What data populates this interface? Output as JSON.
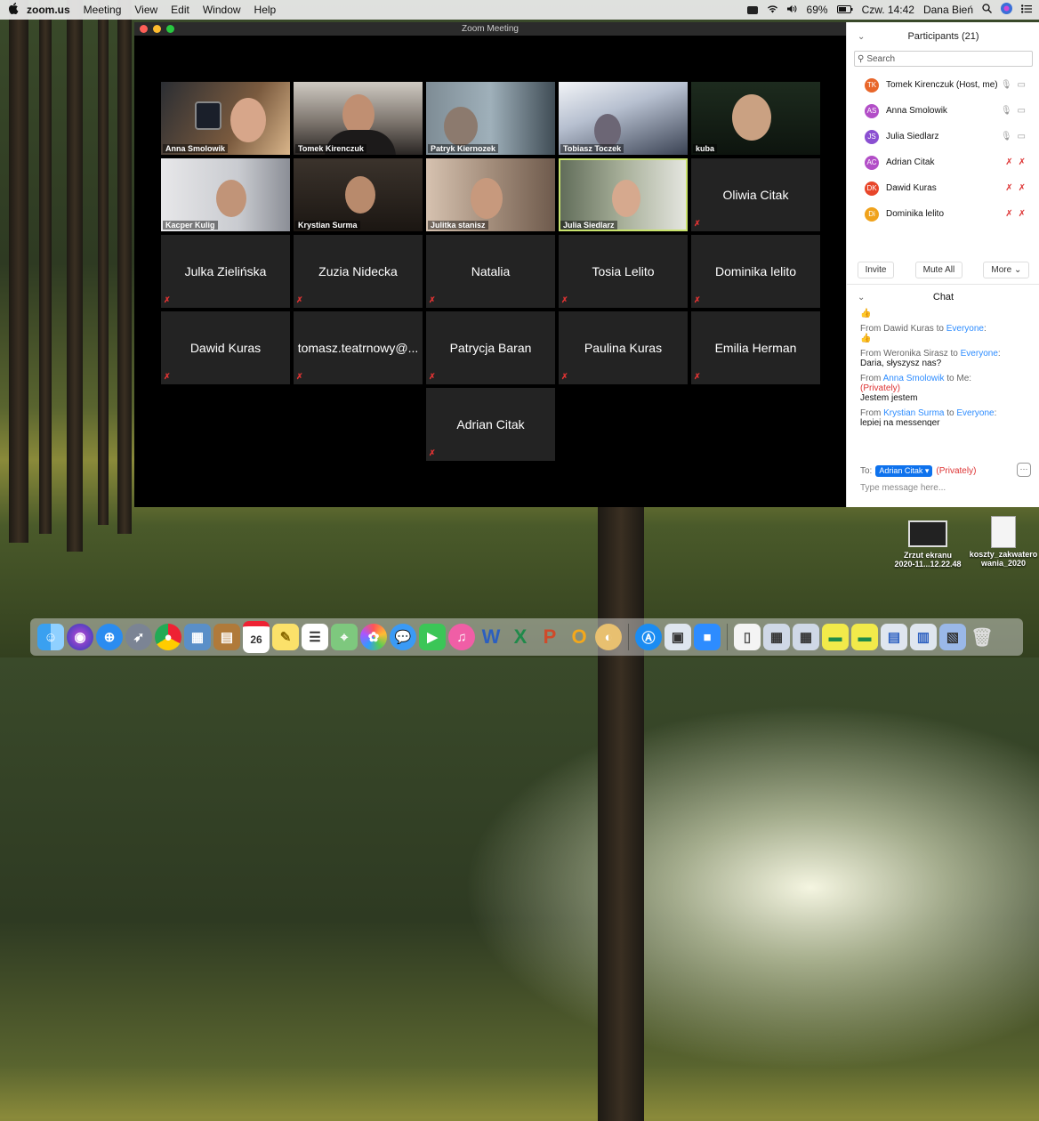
{
  "menubar": {
    "apple": "",
    "items": [
      "zoom.us",
      "Meeting",
      "View",
      "Edit",
      "Window",
      "Help"
    ],
    "battery": "69%",
    "clock": "Czw. 14:42",
    "user": "Dana Bień"
  },
  "window": {
    "title": "Zoom Meeting"
  },
  "tiles": [
    {
      "name": "Anna Smolowik",
      "video": true
    },
    {
      "name": "Tomek Kirenczuk",
      "video": true
    },
    {
      "name": "Patryk Kiernozek",
      "video": true
    },
    {
      "name": "Tobiasz  Toczek",
      "video": true
    },
    {
      "name": "kuba",
      "video": true
    },
    {
      "name": "Kacper Kulig",
      "video": true
    },
    {
      "name": "Krystian Surma",
      "video": true
    },
    {
      "name": "Julitka stanisz",
      "video": true
    },
    {
      "name": "Julia Siedlarz",
      "video": true
    },
    {
      "name": "Oliwia Citak",
      "video": false
    },
    {
      "name": "Julka Zielińska",
      "video": false
    },
    {
      "name": "Zuzia Nidecka",
      "video": false
    },
    {
      "name": "Natalia",
      "video": false
    },
    {
      "name": "Tosia Lelito",
      "video": false
    },
    {
      "name": "Dominika lelito",
      "video": false
    },
    {
      "name": "Dawid Kuras",
      "video": false
    },
    {
      "name": "tomasz.teatrnowy@...",
      "video": false
    },
    {
      "name": "Patrycja Baran",
      "video": false
    },
    {
      "name": "Paulina Kuras",
      "video": false
    },
    {
      "name": "Emilia Herman",
      "video": false
    },
    {
      "name": "Adrian Citak",
      "video": false
    }
  ],
  "participants": {
    "header": "Participants (21)",
    "search_placeholder": "Search",
    "list": [
      {
        "initials": "TK",
        "name": "Tomek Kirenczuk (Host, me)",
        "color": "#e8662a",
        "muted": false
      },
      {
        "initials": "AS",
        "name": "Anna Smolowik",
        "color": "#b24ec7",
        "muted": false
      },
      {
        "initials": "JS",
        "name": "Julia Siedlarz",
        "color": "#8a4fd1",
        "muted": false
      },
      {
        "initials": "AC",
        "name": "Adrian Citak",
        "color": "#b24ec7",
        "muted": true
      },
      {
        "initials": "DK",
        "name": "Dawid Kuras",
        "color": "#e8462a",
        "muted": true
      },
      {
        "initials": "Di",
        "name": "Dominika lelito",
        "color": "#f0a21b",
        "muted": true
      }
    ],
    "invite": "Invite",
    "mute_all": "Mute All",
    "more": "More"
  },
  "chat": {
    "header": "Chat",
    "first_emoji": "👍",
    "messages": [
      {
        "from_prefix": "From ",
        "from": "Dawid Kuras",
        "to_prefix": " to ",
        "to": "Everyone",
        "tail": ":",
        "private": "",
        "text": "👍"
      },
      {
        "from_prefix": "From ",
        "from": "Weronika Sirasz",
        "to_prefix": " to ",
        "to": "Everyone",
        "tail": ":",
        "private": "",
        "text": "Daria, słyszysz nas?"
      },
      {
        "from_prefix": "From ",
        "from": "Anna Smolowik",
        "to_prefix": " to ",
        "to": "Me",
        "tail": ":",
        "private": "(Privately)",
        "text": "Jestem jestem"
      },
      {
        "from_prefix": "From ",
        "from": "Krystian Surma",
        "to_prefix": " to ",
        "to": "Everyone",
        "tail": ":",
        "private": "",
        "text": "lepiej na messenger"
      }
    ],
    "to_label": "To:",
    "recipient": "Adrian Citak ▾",
    "privately": "(Privately)",
    "more_dots": "···",
    "input_placeholder": "Type message here..."
  },
  "desktop_files": [
    {
      "line1": "Zrzut ekranu",
      "line2": "2020-11...12.22.48"
    },
    {
      "line1": "koszty_zakwatero",
      "line2": "wania_2020"
    }
  ],
  "dock": {
    "calendar_day": "26"
  }
}
